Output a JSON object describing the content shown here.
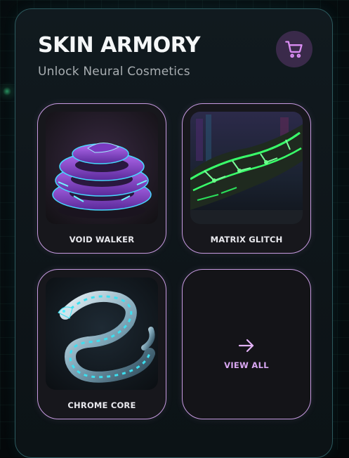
{
  "header": {
    "title": "SKIN ARMORY",
    "subtitle": "Unlock Neural Cosmetics",
    "cart_icon": "shopping-cart-icon"
  },
  "skins": [
    {
      "label": "VOID WALKER",
      "image": "purple-cyber-serpent-coil"
    },
    {
      "label": "MATRIX GLITCH",
      "image": "green-circuit-cyber-arm"
    },
    {
      "label": "CHROME CORE",
      "image": "chrome-cyan-serpent"
    }
  ],
  "view_all": {
    "label": "VIEW ALL",
    "icon": "arrow-right-icon"
  },
  "colors": {
    "accent": "#c69ae0",
    "view_all_text": "#d9a7f2",
    "cart_bg": "#3a2a4a",
    "panel_border": "#2d5a5f"
  }
}
